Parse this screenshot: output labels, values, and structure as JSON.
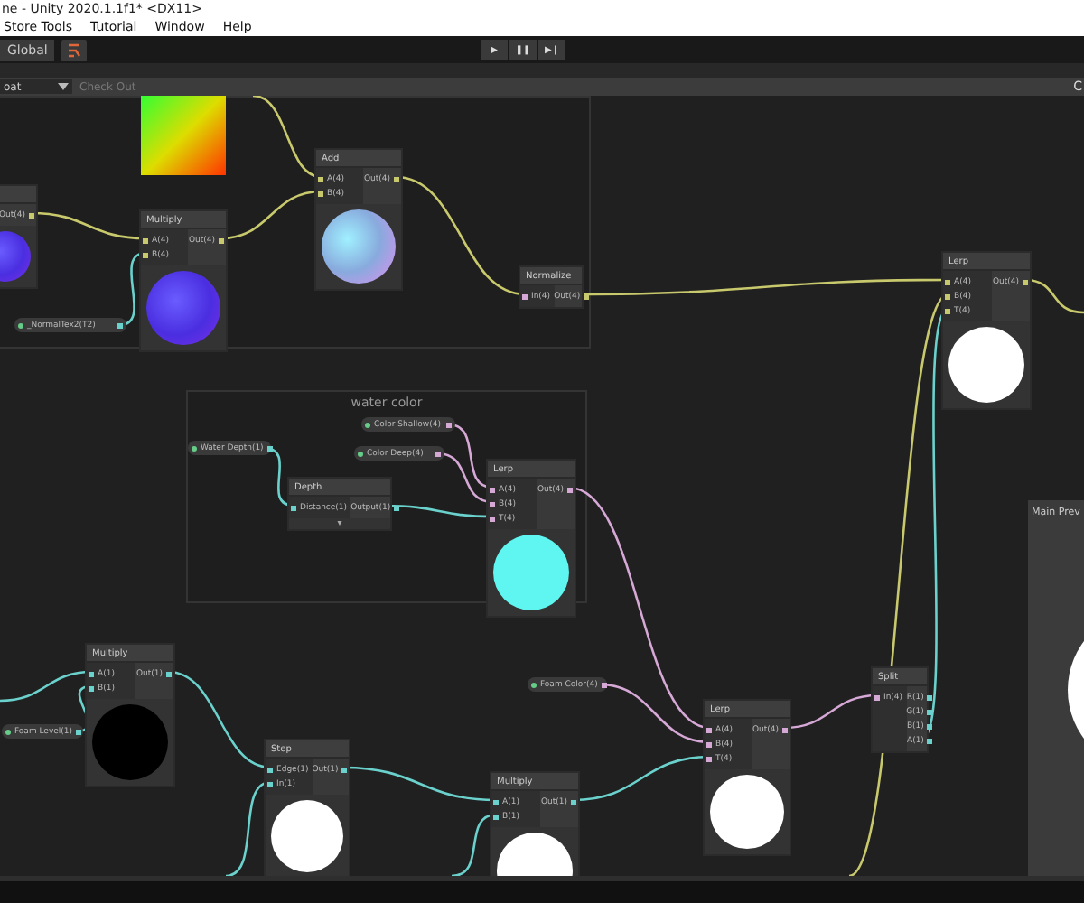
{
  "window": {
    "title": "ne - Unity 2020.1.1f1* <DX11>"
  },
  "menu": [
    "Store Tools",
    "Tutorial",
    "Window",
    "Help"
  ],
  "toolbar": {
    "global_label": "Global",
    "play_buttons": [
      "▶",
      "❚❚",
      "▶❙"
    ]
  },
  "graph_toolbar": {
    "dropdown": "oat",
    "check_out": "Check Out",
    "right_label": "C"
  },
  "groups": [
    {
      "title": "water color"
    }
  ],
  "nodes": [
    {
      "title": "Multiply",
      "kind": "normal",
      "inputs": [
        {
          "label": "A(4)",
          "color": "#c8c86c"
        },
        {
          "label": "B(4)",
          "color": "#c8c86c"
        }
      ],
      "outputs": [
        {
          "label": "Out(4)",
          "color": "#c8c86c"
        }
      ]
    },
    {
      "title": "Add",
      "kind": "normal-light",
      "inputs": [
        {
          "label": "A(4)",
          "color": "#c8c86c"
        },
        {
          "label": "B(4)",
          "color": "#c8c86c"
        }
      ],
      "outputs": [
        {
          "label": "Out(4)",
          "color": "#c8c86c"
        }
      ]
    },
    {
      "title": "Normalize",
      "kind": "plain",
      "inputs": [
        {
          "label": "In(4)",
          "color": "#d6a8d6"
        }
      ],
      "outputs": [
        {
          "label": "Out(4)",
          "color": "#c8c86c"
        }
      ]
    },
    {
      "title": "Depth",
      "kind": "plain",
      "footer": "▾",
      "inputs": [
        {
          "label": "Distance(1)",
          "color": "#6ad1cc"
        }
      ],
      "outputs": [
        {
          "label": "Output(1)",
          "color": "#6ad1cc"
        }
      ]
    },
    {
      "title": "Lerp",
      "kind": "cyan",
      "inputs": [
        {
          "label": "A(4)",
          "color": "#d6a8d6"
        },
        {
          "label": "B(4)",
          "color": "#d6a8d6"
        },
        {
          "label": "T(4)",
          "color": "#d6a8d6"
        }
      ],
      "outputs": [
        {
          "label": "Out(4)",
          "color": "#d6a8d6"
        }
      ]
    },
    {
      "title": "Lerp",
      "kind": "white",
      "inputs": [
        {
          "label": "A(4)",
          "color": "#c8c86c"
        },
        {
          "label": "B(4)",
          "color": "#c8c86c"
        },
        {
          "label": "T(4)",
          "color": "#c8c86c"
        }
      ],
      "outputs": [
        {
          "label": "Out(4)",
          "color": "#c8c86c"
        }
      ]
    },
    {
      "title": "Multiply",
      "kind": "black",
      "inputs": [
        {
          "label": "A(1)",
          "color": "#6ad1cc"
        },
        {
          "label": "B(1)",
          "color": "#6ad1cc"
        }
      ],
      "outputs": [
        {
          "label": "Out(1)",
          "color": "#6ad1cc"
        }
      ]
    },
    {
      "title": "Step",
      "kind": "white",
      "inputs": [
        {
          "label": "Edge(1)",
          "color": "#6ad1cc"
        },
        {
          "label": "In(1)",
          "color": "#6ad1cc"
        }
      ],
      "outputs": [
        {
          "label": "Out(1)",
          "color": "#6ad1cc"
        }
      ]
    },
    {
      "title": "Multiply",
      "kind": "white",
      "inputs": [
        {
          "label": "A(1)",
          "color": "#6ad1cc"
        },
        {
          "label": "B(1)",
          "color": "#6ad1cc"
        }
      ],
      "outputs": [
        {
          "label": "Out(1)",
          "color": "#6ad1cc"
        }
      ]
    },
    {
      "title": "Lerp",
      "kind": "white",
      "inputs": [
        {
          "label": "A(4)",
          "color": "#d6a8d6"
        },
        {
          "label": "B(4)",
          "color": "#d6a8d6"
        },
        {
          "label": "T(4)",
          "color": "#d6a8d6"
        }
      ],
      "outputs": [
        {
          "label": "Out(4)",
          "color": "#d6a8d6"
        }
      ]
    },
    {
      "title": "Split",
      "kind": "plain",
      "inputs": [
        {
          "label": "In(4)",
          "color": "#d6a8d6"
        }
      ],
      "outputs": [
        {
          "label": "R(1)",
          "color": "#6ad1cc"
        },
        {
          "label": "G(1)",
          "color": "#6ad1cc"
        },
        {
          "label": "B(1)",
          "color": "#6ad1cc"
        },
        {
          "label": "A(1)",
          "color": "#6ad1cc"
        }
      ]
    },
    {
      "kind": "normal",
      "outputs": [
        {
          "label": "Out(4)",
          "color": "#c8c86c"
        }
      ]
    }
  ],
  "properties": [
    {
      "label": "_NormalTex2(T2)",
      "color": "#6ad1cc"
    },
    {
      "label": "Water Depth(1)",
      "color": "#6ad1cc"
    },
    {
      "label": "Color Shallow(4)",
      "color": "#d6a8d6"
    },
    {
      "label": "Color Deep(4)",
      "color": "#d6a8d6"
    },
    {
      "label": "Foam Level(1)",
      "color": "#6ad1cc"
    },
    {
      "label": "Foam Color(4)",
      "color": "#d6a8d6"
    }
  ],
  "main_preview": {
    "title": "Main Prev"
  }
}
